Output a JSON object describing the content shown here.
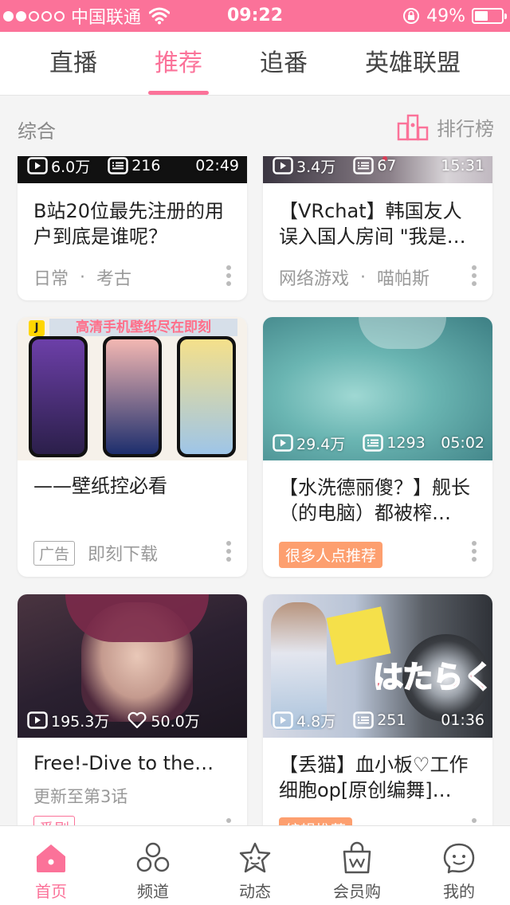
{
  "status_bar": {
    "carrier": "中国联通",
    "time": "09:22",
    "battery": "49%",
    "battery_level": 0.49
  },
  "top_tabs": [
    {
      "label": "直播"
    },
    {
      "label": "推荐",
      "active": true
    },
    {
      "label": "追番"
    },
    {
      "label": "英雄联盟"
    }
  ],
  "section": {
    "title": "综合",
    "rank_label": "排行榜"
  },
  "cards": [
    {
      "plays": "6.0万",
      "danmaku": "216",
      "duration": "02:49",
      "title": "B站20位最先注册的用户到底是谁呢？",
      "category": "日常",
      "subcategory": "考古"
    },
    {
      "plays": "3.4万",
      "danmaku": "67",
      "duration": "15:31",
      "title": "【VRchat】韩国友人误入国人房间 \"我是…",
      "category": "网络游戏",
      "subcategory": "喵帕斯"
    },
    {
      "banner_text": "高清手机壁纸尽在即刻",
      "title": "——壁纸控必看",
      "ad_tag": "广告",
      "ad_source": "即刻下载"
    },
    {
      "plays": "29.4万",
      "danmaku": "1293",
      "duration": "05:02",
      "title": "【水洗德丽傻？】舰长（的电脑）都被榨…",
      "hot_tag": "很多人点推荐"
    },
    {
      "plays": "195.3万",
      "likes": "50.0万",
      "title": "Free!-Dive to the…",
      "update": "更新至第3话",
      "tag": "番剧"
    },
    {
      "plays": "4.8万",
      "danmaku": "251",
      "duration": "01:36",
      "title": "【丢猫】血小板♡工作细胞op[原创编舞]…",
      "overlay_text": "はたらく細胞",
      "tag": "编辑推荐"
    }
  ],
  "bottom_nav": [
    {
      "label": "首页",
      "active": true,
      "icon": "home-icon"
    },
    {
      "label": "频道",
      "icon": "channel-icon"
    },
    {
      "label": "动态",
      "icon": "dynamic-icon"
    },
    {
      "label": "会员购",
      "icon": "shopping-bag-icon"
    },
    {
      "label": "我的",
      "icon": "profile-icon"
    }
  ],
  "colors": {
    "accent": "#fb7299",
    "hot_tag": "#fd9f6f"
  }
}
